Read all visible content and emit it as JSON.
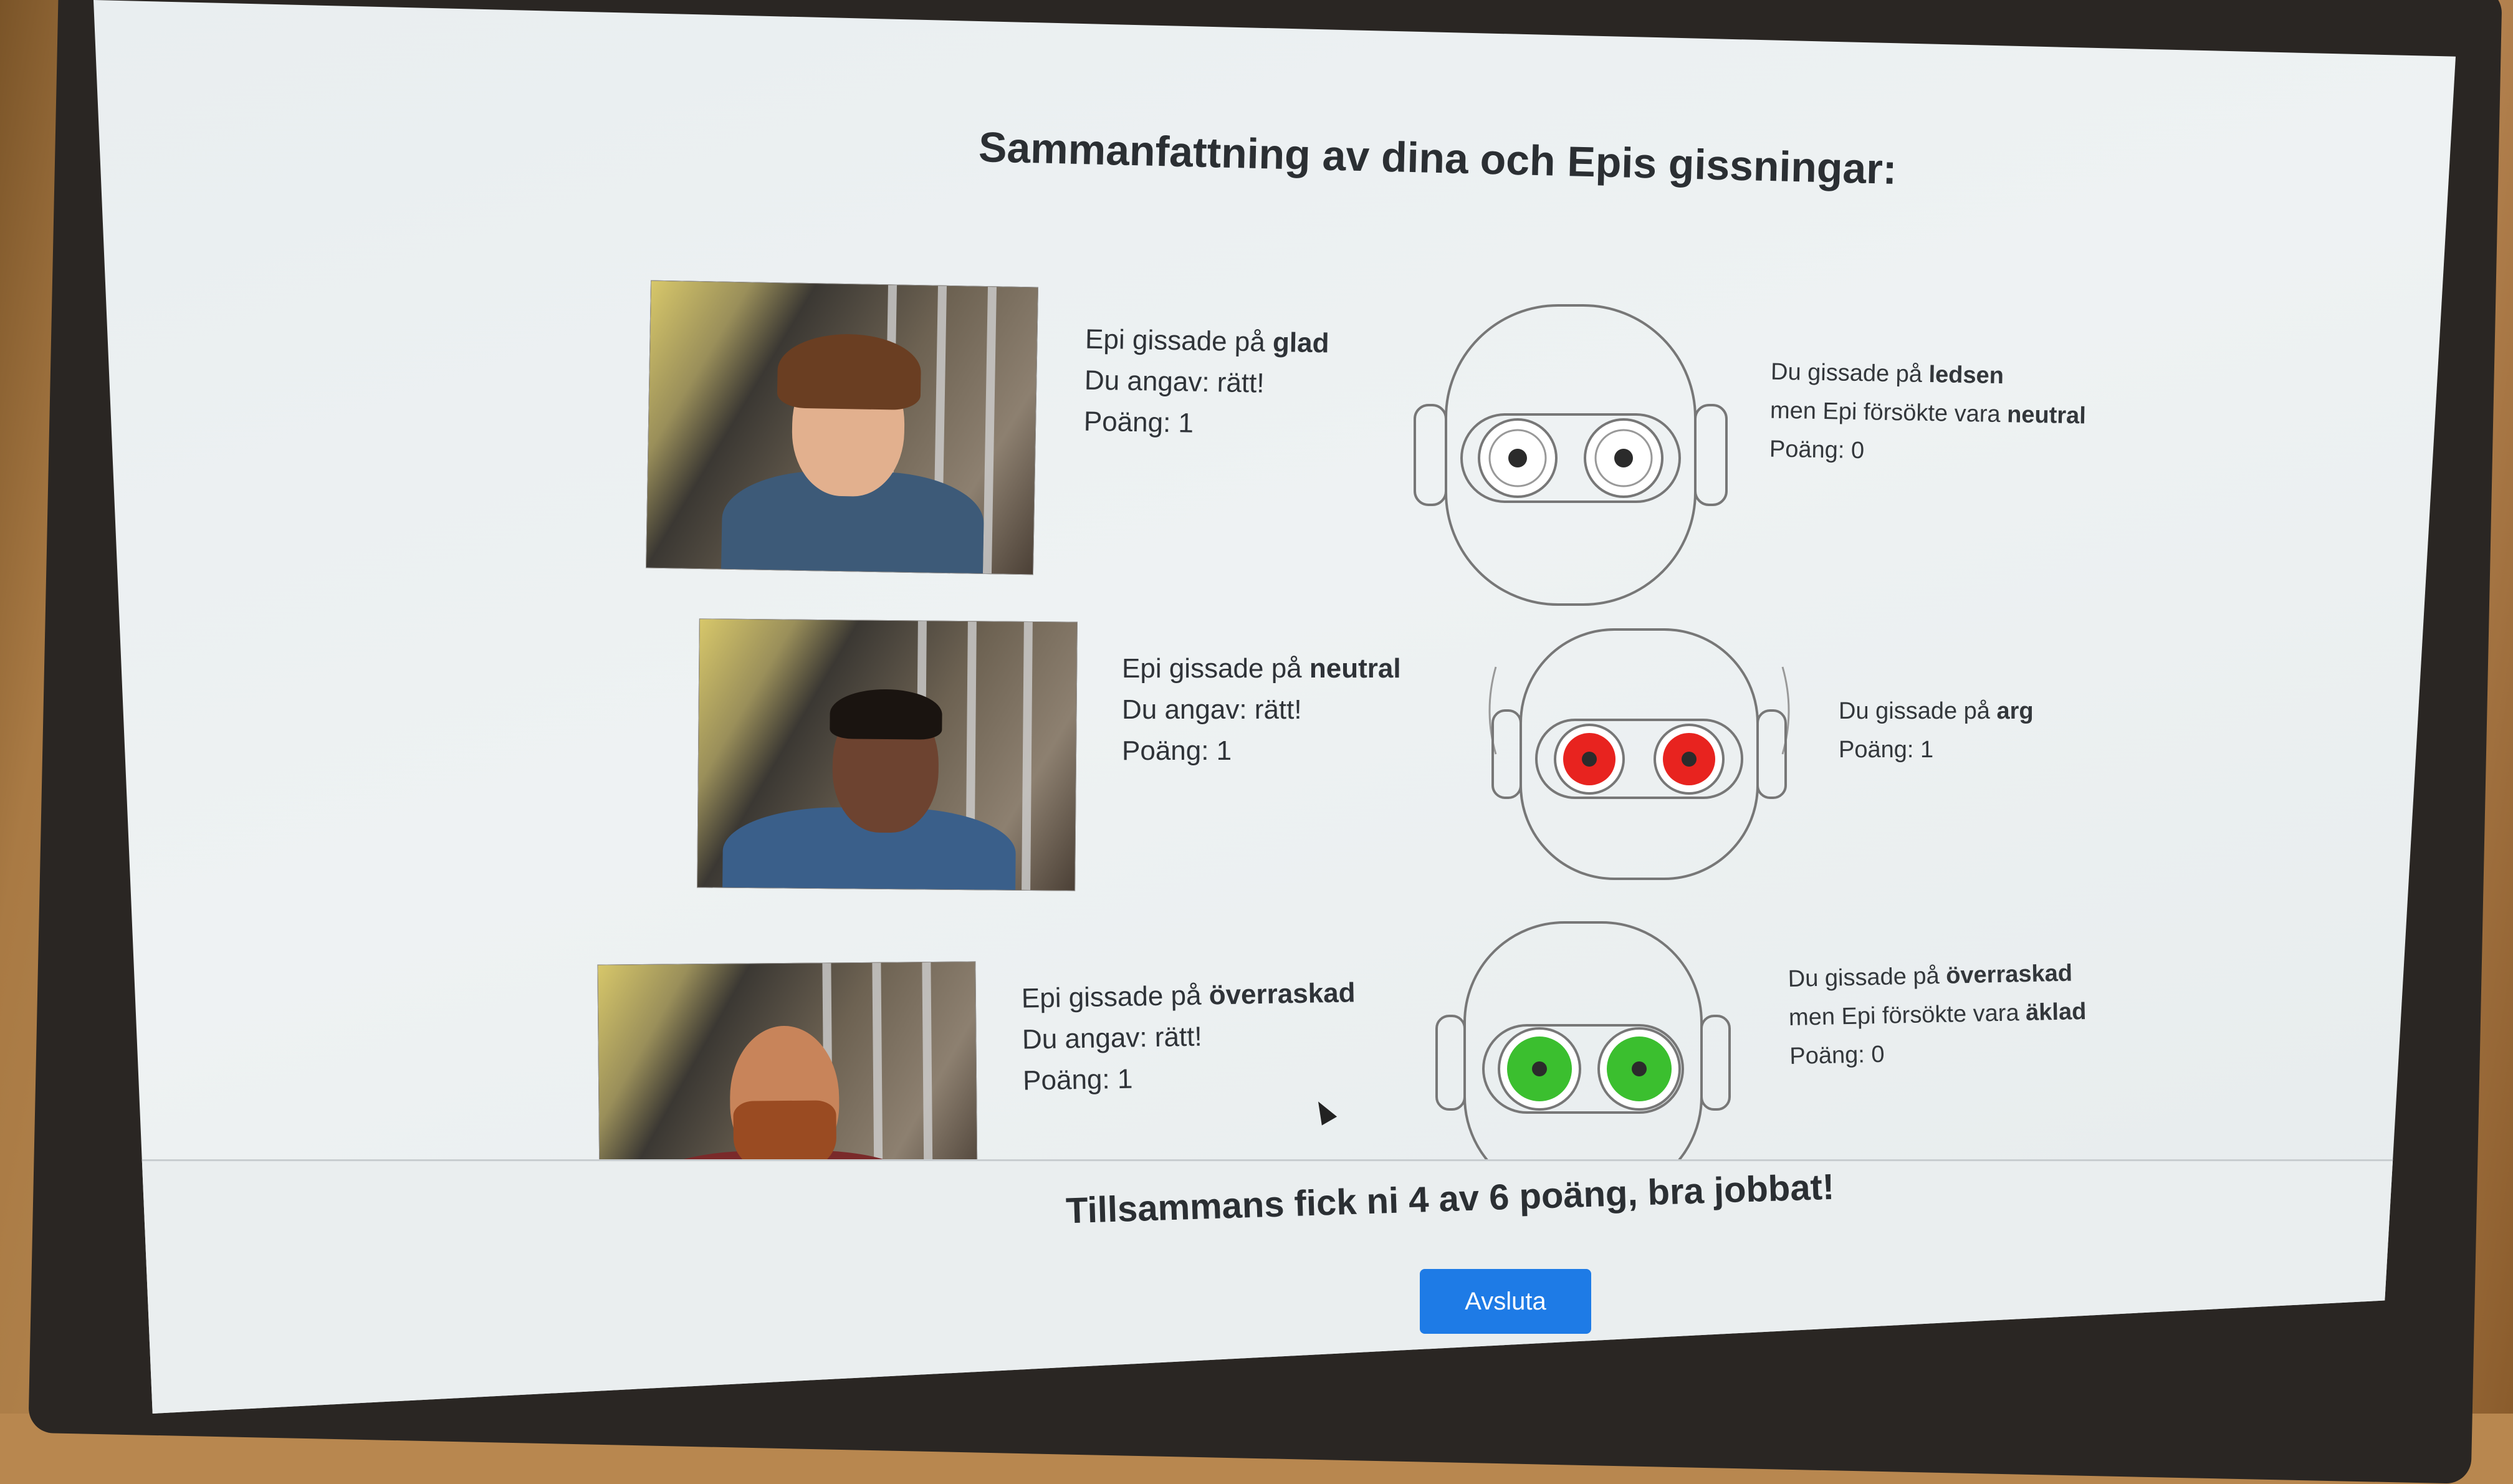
{
  "page": {
    "title": "Sammanfattning av dina och Epis gissningar:",
    "summary": "Tillsammans fick ni 4 av 6 poäng, bra jobbat!",
    "finish_label": "Avsluta"
  },
  "rounds": [
    {
      "epi_prefix": "Epi gissade på ",
      "epi_guess": "glad",
      "you_said": "Du angav: rätt!",
      "points": "Poäng: 1",
      "robot_eye_color": "#2b2b2b",
      "robot_eye_bg": "#ffffff",
      "you_prefix": "Du gissade på ",
      "you_guess": "ledsen",
      "epi_tried_prefix": "men Epi försökte vara ",
      "epi_tried": "neutral",
      "robot_points": "Poäng: 0"
    },
    {
      "epi_prefix": "Epi gissade på ",
      "epi_guess": "neutral",
      "you_said": "Du angav: rätt!",
      "points": "Poäng: 1",
      "robot_eye_color": "#2b2b2b",
      "robot_eye_bg": "#e8231f",
      "you_prefix": "Du gissade på ",
      "you_guess": "arg",
      "robot_points": "Poäng: 1"
    },
    {
      "epi_prefix": "Epi gissade på ",
      "epi_guess": "överraskad",
      "you_said": "Du angav: rätt!",
      "points": "Poäng: 1",
      "robot_eye_color": "#2b2b2b",
      "robot_eye_bg": "#3bbf2f",
      "you_prefix": "Du gissade på ",
      "you_guess": "överraskad",
      "epi_tried_prefix": "men Epi försökte vara ",
      "epi_tried": "äklad",
      "robot_points": "Poäng: 0"
    }
  ],
  "colors": {
    "button": "#1e7be6",
    "text": "#2f3338"
  }
}
